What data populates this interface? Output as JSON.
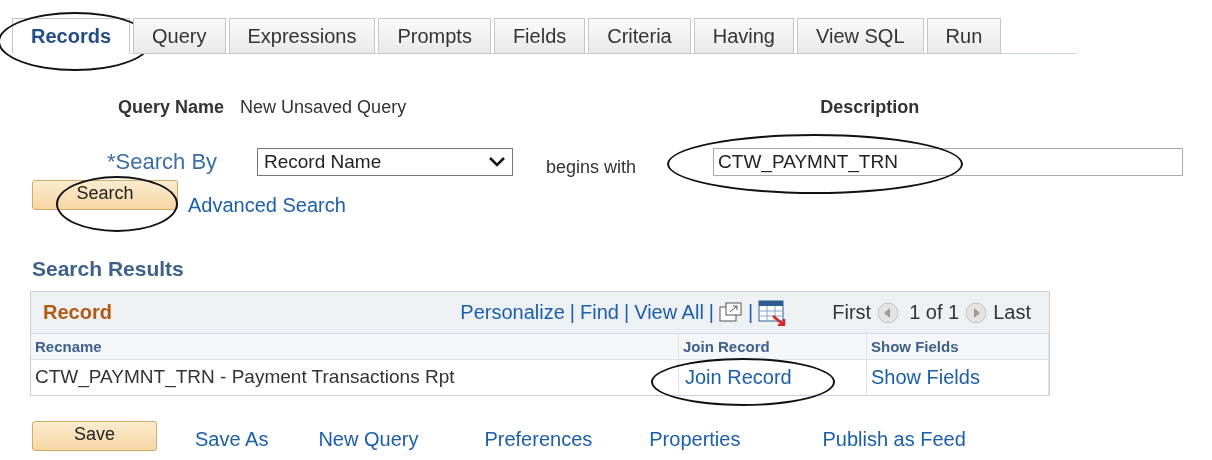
{
  "tabs": [
    {
      "label": "Records",
      "selected": true,
      "circled": true
    },
    {
      "label": "Query",
      "selected": false,
      "circled": false
    },
    {
      "label": "Expressions",
      "selected": false,
      "circled": false
    },
    {
      "label": "Prompts",
      "selected": false,
      "circled": false
    },
    {
      "label": "Fields",
      "selected": false,
      "circled": false
    },
    {
      "label": "Criteria",
      "selected": false,
      "circled": false
    },
    {
      "label": "Having",
      "selected": false,
      "circled": false
    },
    {
      "label": "View SQL",
      "selected": false,
      "circled": false
    },
    {
      "label": "Run",
      "selected": false,
      "circled": false
    }
  ],
  "query_name": {
    "label": "Query Name",
    "value": "New Unsaved Query"
  },
  "description": {
    "label": "Description",
    "value": "CTW_PAYMNT_TRN",
    "circled": true
  },
  "search_by": {
    "label": "*Search By",
    "value": "Record Name",
    "operator": "begins with"
  },
  "search_button": {
    "label": "Search",
    "circled": true
  },
  "advanced_search": "Advanced Search",
  "search_results": {
    "title": "Search Results",
    "grid": {
      "title": "Record",
      "links": [
        "Personalize",
        "Find",
        "View All"
      ],
      "separator": "|",
      "first": "First",
      "count": "1 of 1",
      "last": "Last",
      "columns": [
        "Recname",
        "Join Record",
        "Show Fields"
      ],
      "rows": [
        {
          "recname": "CTW_PAYMNT_TRN - Payment Transactions Rpt",
          "join": "Join Record",
          "join_circled": true,
          "show": "Show Fields"
        }
      ]
    }
  },
  "footer": {
    "save": "Save",
    "links": [
      "Save As",
      "New Query",
      "Preferences",
      "Properties",
      "Publish as Feed"
    ]
  }
}
